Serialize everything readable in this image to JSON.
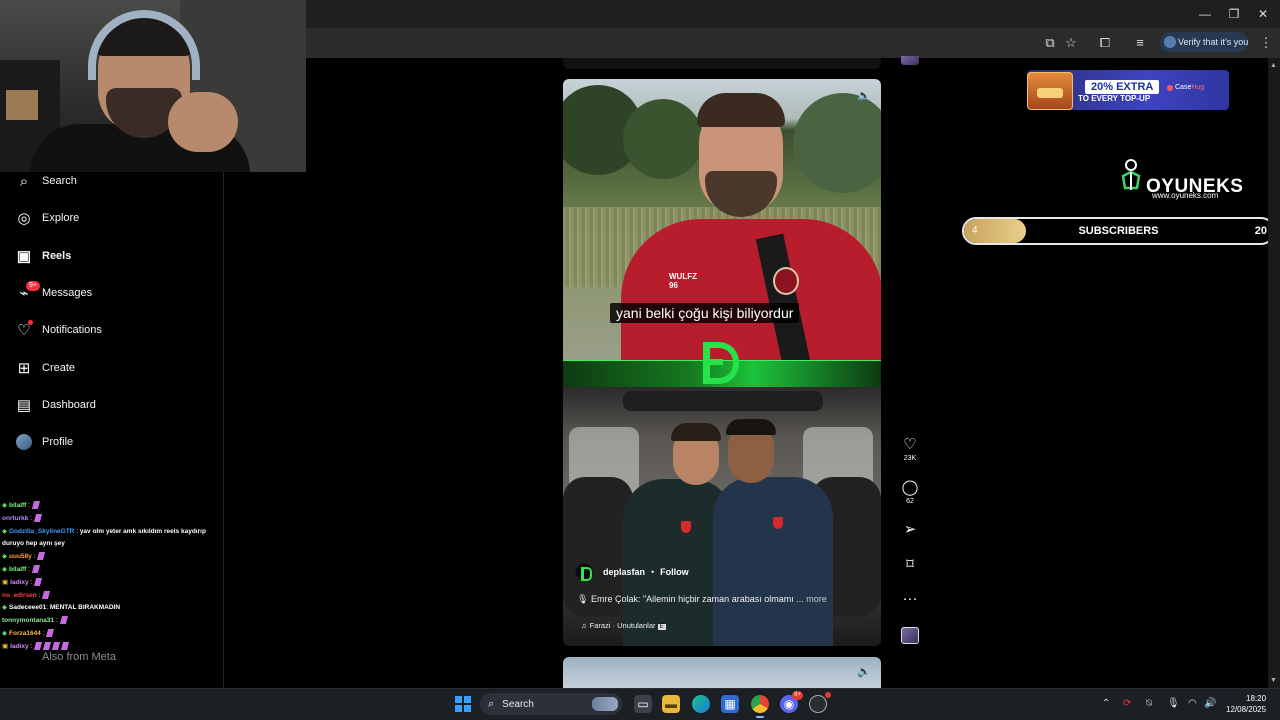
{
  "browser": {
    "verify_label": "Verify that it's you",
    "window_controls": [
      "minimize-icon",
      "restore-icon",
      "close-icon"
    ],
    "toolbar_icons": [
      "cast-icon",
      "star-icon",
      "extensions-icon",
      "reading-list-icon",
      "menu-icon"
    ]
  },
  "sidebar": {
    "items": [
      {
        "label": "Search",
        "icon": "search-icon"
      },
      {
        "label": "Explore",
        "icon": "compass-icon"
      },
      {
        "label": "Reels",
        "icon": "reels-icon",
        "active": true
      },
      {
        "label": "Messages",
        "icon": "messenger-icon",
        "badge": "9+"
      },
      {
        "label": "Notifications",
        "icon": "heart-icon",
        "dot": true
      },
      {
        "label": "Create",
        "icon": "plus-square-icon"
      },
      {
        "label": "Dashboard",
        "icon": "chart-icon"
      },
      {
        "label": "Profile",
        "icon": "avatar-icon"
      }
    ],
    "also_from_meta": "Also from Meta"
  },
  "chat": {
    "messages": [
      {
        "user": "bilalff",
        "color": "#7cf37c",
        "text": ""
      },
      {
        "user": "onrturkk",
        "color": "#b38cff",
        "text": ""
      },
      {
        "user": "Godzilla_SkylineGTR",
        "color": "#3f9dff",
        "text": "yav olm yeter amk sıkıldım reels kaydırıp duruyo hep aynı şey"
      },
      {
        "user": "uuu58y",
        "color": "#ff9f40",
        "text": ""
      },
      {
        "user": "bilalff",
        "color": "#7cf37c",
        "text": ""
      },
      {
        "user": "ladixy",
        "color": "#d08bff",
        "text": ""
      },
      {
        "user": "no_edirsen",
        "color": "#ff4040",
        "text": ""
      },
      {
        "user": "Sadeceee01",
        "color": "#ffffff",
        "text": "MENTAL BIRAKMADIN"
      },
      {
        "user": "tonnymontana31",
        "color": "#9ae59a",
        "text": ""
      },
      {
        "user": "Forza1644",
        "color": "#ffb84d",
        "text": ""
      },
      {
        "user": "ladixy",
        "color": "#d08bff",
        "text": ""
      }
    ]
  },
  "reel": {
    "subtitle": "yani belki çoğu kişi biliyordur",
    "jersey_text": "WULFZ",
    "jersey_number": "96",
    "mute_icon": "speaker-icon",
    "account": "deplasfan",
    "follow_label": "Follow",
    "caption": "Emre Çolak: \"Ailemin hiçbir zaman arabası olmamı ...",
    "caption_more": "more",
    "audio": "Farazi · Unutulanlar",
    "audio_explicit": "E",
    "likes": "23K",
    "comments": "62"
  },
  "overlay": {
    "ad_percent": "20% EXTRA",
    "ad_line2": "TO EVERY TOP-UP",
    "ad_brand": "Case",
    "ad_brand_accent": "Hug",
    "logo_text": "OYUNEKS",
    "logo_url": "www.oyuneks.com",
    "subs_current": "4",
    "subs_label": "SUBSCRIBERS",
    "subs_goal": "20",
    "subs_progress": 0.2
  },
  "taskbar": {
    "search_label": "Search",
    "discord_badge": "9+",
    "time": "18:20",
    "date": "12/08/2025"
  },
  "colors": {
    "accent_green": "#27e34a",
    "jersey_red": "#b81d2e",
    "notification_red": "#ff3040"
  }
}
